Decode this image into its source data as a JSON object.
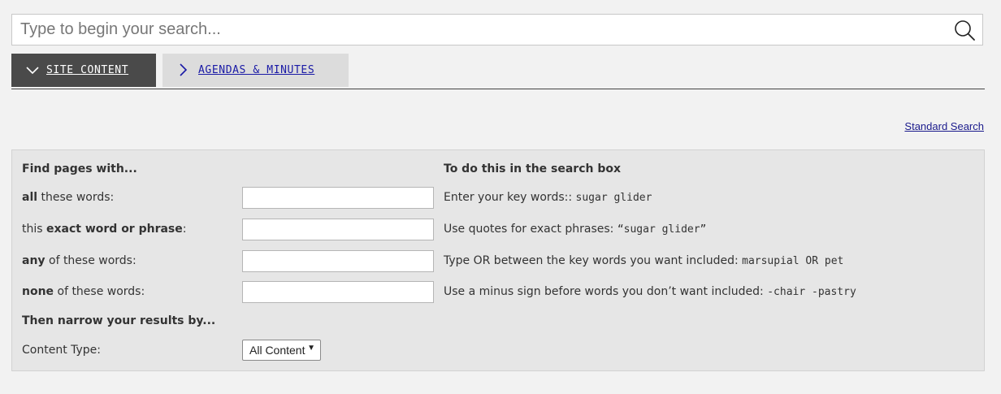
{
  "search": {
    "placeholder": "Type to begin your search..."
  },
  "tabs": [
    {
      "label": "SITE CONTENT",
      "active": true
    },
    {
      "label": "AGENDAS & MINUTES",
      "active": false
    }
  ],
  "standard_search_link": "Standard Search",
  "advanced": {
    "left_heading": "Find pages with...",
    "right_heading": "To do this in the search box",
    "rows": [
      {
        "label_bold": "all",
        "label_rest": " these words:",
        "help_text": "Enter your key words:: ",
        "help_example": "sugar glider"
      },
      {
        "label_pre": "this ",
        "label_bold": "exact word or phrase",
        "label_rest": ":",
        "help_text": "Use quotes for exact phrases: ",
        "help_example": "“sugar glider”"
      },
      {
        "label_bold": "any",
        "label_rest": " of these words:",
        "help_text": "Type OR between the key words you want included: ",
        "help_example": "marsupial OR pet"
      },
      {
        "label_bold": "none",
        "label_rest": " of these words:",
        "help_text": "Use a minus sign before words you don’t want included: ",
        "help_example": "-chair -pastry"
      }
    ],
    "narrow_heading": "Then narrow your results by...",
    "content_type_label": "Content Type:",
    "content_type_value": "All Content"
  },
  "colors": {
    "active_tab_bg": "#4a4a4a",
    "inactive_tab_bg": "#dcdcdc",
    "link_color": "#1a1aa6"
  }
}
